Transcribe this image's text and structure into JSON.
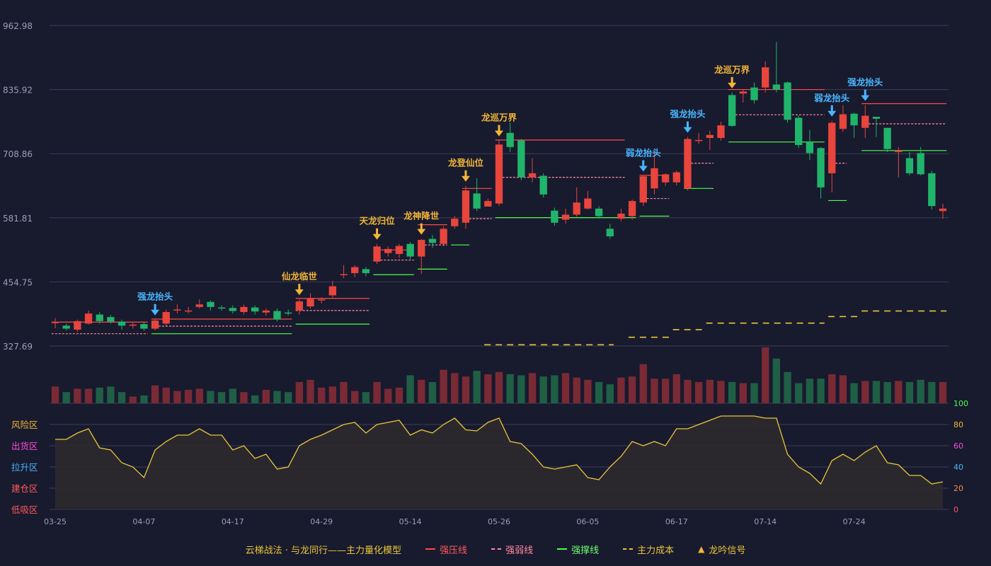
{
  "colors": {
    "background": "#181a2e",
    "up": "#e8453c",
    "down": "#20b46a",
    "strong_press": "#ff4a4a",
    "weak_line": "#ff8aa0",
    "support": "#4cff4c",
    "cost": "#e8c53a",
    "signal_gold": "#f2b637",
    "signal_blue": "#49b6ff",
    "oscillator": "#e8c53a",
    "grid": "#3b3e55",
    "axis_text": "#9aa0b4"
  },
  "chart_data": {
    "type": "candlestick",
    "y_axis_labels": [
      "962.98",
      "835.92",
      "708.86",
      "581.81",
      "454.75",
      "327.69"
    ],
    "ylim": [
      327.69,
      962.98
    ],
    "x_tick_labels": [
      {
        "index": 0,
        "label": "03-25"
      },
      {
        "index": 8,
        "label": "04-07"
      },
      {
        "index": 16,
        "label": "04-17"
      },
      {
        "index": 24,
        "label": "04-29"
      },
      {
        "index": 32,
        "label": "05-14"
      },
      {
        "index": 40,
        "label": "05-26"
      },
      {
        "index": 48,
        "label": "06-05"
      },
      {
        "index": 56,
        "label": "06-17"
      },
      {
        "index": 64,
        "label": "07-14"
      },
      {
        "index": 72,
        "label": "07-24"
      }
    ],
    "candles": [
      [
        375,
        375,
        383,
        363
      ],
      [
        368,
        362,
        372,
        358
      ],
      [
        360,
        377,
        380,
        356
      ],
      [
        372,
        392,
        398,
        370
      ],
      [
        390,
        377,
        395,
        372
      ],
      [
        385,
        376,
        389,
        372
      ],
      [
        376,
        368,
        380,
        360
      ],
      [
        368,
        370,
        374,
        362
      ],
      [
        371,
        362,
        374,
        358
      ],
      [
        362,
        378,
        380,
        358
      ],
      [
        372,
        395,
        400,
        368
      ],
      [
        400,
        400,
        410,
        392
      ],
      [
        398,
        398,
        405,
        392
      ],
      [
        405,
        410,
        420,
        402
      ],
      [
        415,
        405,
        418,
        398
      ],
      [
        404,
        402,
        408,
        398
      ],
      [
        403,
        397,
        408,
        392
      ],
      [
        395,
        405,
        410,
        390
      ],
      [
        404,
        396,
        408,
        390
      ],
      [
        394,
        398,
        402,
        388
      ],
      [
        397,
        380,
        402,
        376
      ],
      [
        394,
        393,
        400,
        388
      ],
      [
        398,
        416,
        420,
        390
      ],
      [
        406,
        422,
        432,
        402
      ],
      [
        418,
        420,
        424,
        412
      ],
      [
        428,
        446,
        456,
        424
      ],
      [
        470,
        470,
        488,
        462
      ],
      [
        472,
        484,
        488,
        464
      ],
      [
        480,
        472,
        484,
        466
      ],
      [
        495,
        525,
        530,
        490
      ],
      [
        512,
        520,
        525,
        505
      ],
      [
        510,
        526,
        530,
        502
      ],
      [
        530,
        505,
        534,
        500
      ],
      [
        505,
        538,
        540,
        470
      ],
      [
        540,
        532,
        548,
        522
      ],
      [
        530,
        560,
        565,
        525
      ],
      [
        565,
        580,
        585,
        560
      ],
      [
        572,
        636,
        645,
        560
      ],
      [
        630,
        600,
        660,
        595
      ],
      [
        604,
        615,
        620,
        608
      ],
      [
        610,
        727,
        735,
        605
      ],
      [
        750,
        722,
        770,
        712
      ],
      [
        735,
        662,
        738,
        656
      ],
      [
        662,
        670,
        700,
        652
      ],
      [
        665,
        628,
        670,
        622
      ],
      [
        596,
        572,
        602,
        566
      ],
      [
        578,
        588,
        600,
        570
      ],
      [
        588,
        612,
        642,
        584
      ],
      [
        600,
        620,
        635,
        598
      ],
      [
        600,
        585,
        605,
        580
      ],
      [
        560,
        545,
        570,
        540
      ],
      [
        580,
        590,
        600,
        575
      ],
      [
        585,
        615,
        618,
        578
      ],
      [
        612,
        664,
        665,
        605
      ],
      [
        640,
        680,
        712,
        628
      ],
      [
        652,
        668,
        670,
        645
      ],
      [
        652,
        672,
        675,
        646
      ],
      [
        640,
        738,
        742,
        636
      ],
      [
        734,
        736,
        750,
        728
      ],
      [
        740,
        746,
        754,
        716
      ],
      [
        740,
        765,
        772,
        735
      ],
      [
        825,
        764,
        830,
        762
      ],
      [
        828,
        832,
        835,
        810
      ],
      [
        840,
        815,
        850,
        808
      ],
      [
        840,
        880,
        892,
        830
      ],
      [
        846,
        836,
        930,
        830
      ],
      [
        850,
        776,
        852,
        770
      ],
      [
        780,
        726,
        785,
        720
      ],
      [
        732,
        710,
        756,
        696
      ],
      [
        720,
        642,
        722,
        620
      ],
      [
        670,
        770,
        774,
        632
      ],
      [
        758,
        787,
        805,
        752
      ],
      [
        788,
        765,
        790,
        740
      ],
      [
        760,
        784,
        805,
        740
      ],
      [
        782,
        778,
        780,
        742
      ],
      [
        760,
        718,
        760,
        712
      ],
      [
        712,
        715,
        722,
        662
      ],
      [
        700,
        670,
        712,
        666
      ],
      [
        710,
        668,
        722,
        666
      ],
      [
        670,
        605,
        675,
        598
      ],
      [
        595,
        600,
        610,
        580
      ]
    ],
    "volumes": [
      30,
      20,
      26,
      26,
      28,
      30,
      20,
      12,
      14,
      32,
      28,
      22,
      24,
      26,
      22,
      20,
      26,
      20,
      14,
      24,
      22,
      20,
      38,
      42,
      28,
      30,
      38,
      22,
      20,
      38,
      26,
      28,
      50,
      42,
      38,
      60,
      54,
      48,
      58,
      52,
      56,
      52,
      50,
      54,
      48,
      50,
      54,
      46,
      42,
      38,
      34,
      46,
      48,
      70,
      44,
      44,
      52,
      42,
      38,
      42,
      40,
      38,
      36,
      36,
      100,
      80,
      56,
      36,
      44,
      44,
      52,
      50,
      36,
      40,
      40,
      38,
      40,
      38,
      42,
      38,
      38
    ],
    "oscillator": {
      "labels": {
        "risk": "风险区",
        "ship": "出货区",
        "lift": "拉升区",
        "build": "建仓区",
        "absorb": "低吸区"
      },
      "ticks": [
        "100",
        "80",
        "60",
        "40",
        "20",
        "0"
      ],
      "values": [
        66,
        66,
        72,
        76,
        58,
        56,
        44,
        40,
        30,
        56,
        64,
        70,
        70,
        76,
        70,
        70,
        56,
        60,
        48,
        52,
        38,
        40,
        60,
        66,
        70,
        75,
        80,
        82,
        72,
        80,
        82,
        84,
        70,
        75,
        72,
        80,
        86,
        75,
        74,
        82,
        86,
        64,
        62,
        52,
        40,
        38,
        40,
        42,
        30,
        28,
        40,
        50,
        64,
        60,
        64,
        60,
        76,
        76,
        80,
        84,
        88,
        88,
        88,
        88,
        86,
        86,
        52,
        40,
        34,
        24,
        46,
        52,
        46,
        54,
        60,
        44,
        42,
        32,
        32,
        24,
        26
      ]
    },
    "signals": [
      {
        "index": 9,
        "label": "强龙抬头",
        "kind": "blue"
      },
      {
        "index": 22,
        "label": "仙龙临世",
        "kind": "gold"
      },
      {
        "index": 29,
        "label": "天龙归位",
        "kind": "gold"
      },
      {
        "index": 33,
        "label": "龙神降世",
        "kind": "gold"
      },
      {
        "index": 37,
        "label": "龙登仙位",
        "kind": "gold"
      },
      {
        "index": 40,
        "label": "龙巡万界",
        "kind": "gold"
      },
      {
        "index": 53,
        "label": "弱龙抬头",
        "kind": "blue"
      },
      {
        "index": 57,
        "label": "强龙抬头",
        "kind": "blue"
      },
      {
        "index": 61,
        "label": "龙巡万界",
        "kind": "gold"
      },
      {
        "index": 70,
        "label": "弱龙抬头",
        "kind": "blue"
      },
      {
        "index": 73,
        "label": "强龙抬头",
        "kind": "blue"
      }
    ],
    "segments": [
      {
        "type": "strong_press",
        "x1": 0,
        "x2": 8,
        "y": 375
      },
      {
        "type": "weak",
        "x1": 0,
        "x2": 8,
        "y": 352
      },
      {
        "type": "strong_press",
        "x1": 9,
        "x2": 21,
        "y": 381
      },
      {
        "type": "weak",
        "x1": 9,
        "x2": 21,
        "y": 367
      },
      {
        "type": "support",
        "x1": 9,
        "x2": 21,
        "y": 352
      },
      {
        "type": "strong_press",
        "x1": 22,
        "x2": 28,
        "y": 422
      },
      {
        "type": "weak",
        "x1": 22,
        "x2": 28,
        "y": 398
      },
      {
        "type": "support",
        "x1": 22,
        "x2": 28,
        "y": 371
      },
      {
        "type": "strong_press",
        "x1": 29,
        "x2": 32,
        "y": 518
      },
      {
        "type": "weak",
        "x1": 29,
        "x2": 32,
        "y": 498
      },
      {
        "type": "support",
        "x1": 29,
        "x2": 32,
        "y": 469
      },
      {
        "type": "strong_press",
        "x1": 33,
        "x2": 35,
        "y": 568
      },
      {
        "type": "weak",
        "x1": 33,
        "x2": 35,
        "y": 528
      },
      {
        "type": "support",
        "x1": 33,
        "x2": 35,
        "y": 480
      },
      {
        "type": "support",
        "x1": 36,
        "x2": 37,
        "y": 528
      },
      {
        "type": "strong_press",
        "x1": 37,
        "x2": 39,
        "y": 640
      },
      {
        "type": "weak",
        "x1": 37,
        "x2": 39,
        "y": 580
      },
      {
        "type": "strong_press",
        "x1": 40,
        "x2": 51,
        "y": 736
      },
      {
        "type": "weak",
        "x1": 40,
        "x2": 51,
        "y": 662
      },
      {
        "type": "support",
        "x1": 40,
        "x2": 52,
        "y": 582
      },
      {
        "type": "strong_press",
        "x1": 53,
        "x2": 55,
        "y": 666
      },
      {
        "type": "weak",
        "x1": 53,
        "x2": 55,
        "y": 620
      },
      {
        "type": "support",
        "x1": 53,
        "x2": 55,
        "y": 585
      },
      {
        "type": "weak",
        "x1": 57,
        "x2": 59,
        "y": 690
      },
      {
        "type": "support",
        "x1": 57,
        "x2": 59,
        "y": 640
      },
      {
        "type": "strong_press",
        "x1": 61,
        "x2": 69,
        "y": 836
      },
      {
        "type": "weak",
        "x1": 61,
        "x2": 69,
        "y": 786
      },
      {
        "type": "support",
        "x1": 61,
        "x2": 69,
        "y": 732
      },
      {
        "type": "weak",
        "x1": 70,
        "x2": 71,
        "y": 690
      },
      {
        "type": "support",
        "x1": 70,
        "x2": 71,
        "y": 616
      },
      {
        "type": "strong_press",
        "x1": 73,
        "x2": 80,
        "y": 808
      },
      {
        "type": "weak",
        "x1": 73,
        "x2": 80,
        "y": 768
      },
      {
        "type": "support",
        "x1": 73,
        "x2": 80,
        "y": 715
      }
    ],
    "cost_segments": [
      {
        "x1": 39,
        "x2": 50,
        "y": 330
      },
      {
        "x1": 52,
        "x2": 55,
        "y": 345
      },
      {
        "x1": 56,
        "x2": 58,
        "y": 360
      },
      {
        "x1": 59,
        "x2": 69,
        "y": 373
      },
      {
        "x1": 70,
        "x2": 72,
        "y": 386
      },
      {
        "x1": 73,
        "x2": 80,
        "y": 397
      }
    ]
  },
  "legend": {
    "title": "云梯战法 · 与龙同行——主力量化模型",
    "items": [
      {
        "label": "强压线"
      },
      {
        "label": "强弱线"
      },
      {
        "label": "强撑线"
      },
      {
        "label": "主力成本"
      },
      {
        "label": "龙吟信号"
      }
    ]
  }
}
